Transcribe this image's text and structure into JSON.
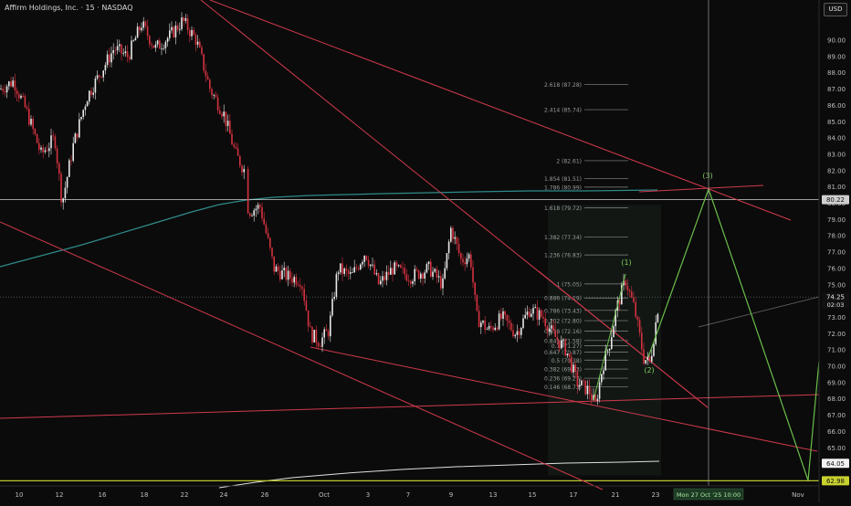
{
  "header": {
    "title": "Affirm Holdings, Inc. · 15 · NASDAQ",
    "currency_button": "USD"
  },
  "chart_data": {
    "type": "candlestick",
    "ticker_title": "Affirm Holdings, Inc. · 15 · NASDAQ",
    "ylim": [
      62.6,
      91.4
    ],
    "y_ticks": [
      63,
      64,
      65,
      66,
      67,
      68,
      69,
      70,
      71,
      72,
      73,
      74,
      75,
      76,
      77,
      78,
      79,
      80,
      81,
      82,
      83,
      84,
      85,
      86,
      87,
      88,
      89,
      90
    ],
    "y_tick_labels": [
      "63.00",
      "64.00",
      "65.00",
      "66.00",
      "67.00",
      "68.00",
      "69.00",
      "70.00",
      "71.00",
      "72.00",
      "73.00",
      "74.00",
      "75.00",
      "76.00",
      "77.00",
      "78.00",
      "79.00",
      "80.00",
      "81.00",
      "82.00",
      "83.00",
      "84.00",
      "85.00",
      "86.00",
      "87.00",
      "88.00",
      "89.00",
      "90.00"
    ],
    "x_tick_labels": [
      "10",
      "12",
      "16",
      "18",
      "22",
      "24",
      "26",
      "Oct",
      "3",
      "7",
      "9",
      "13",
      "15",
      "17",
      "21",
      "23",
      "Nov"
    ],
    "price_labels": [
      {
        "value": 80.22,
        "text": "80.22",
        "bg": "#cfcfcf",
        "fg": "#111111"
      },
      {
        "value": 74.25,
        "text": "74.25",
        "sub": "02:03",
        "bg": "#101010",
        "fg": "#e8e8e8"
      },
      {
        "value": 64.05,
        "text": "64.05",
        "bg": "#f2f2f2",
        "fg": "#111111"
      },
      {
        "value": 62.98,
        "text": "62.98",
        "bg": "#c9d12f",
        "fg": "#111111"
      }
    ],
    "crosshair": {
      "value": 80.22,
      "time_label": "Mon 27 Oct '25   10:00"
    },
    "fibonacci_levels": [
      {
        "label": "0.146 (68.73)",
        "value": 68.73
      },
      {
        "label": "0.236 (69.27)",
        "value": 69.27
      },
      {
        "label": "0.382 (69.83)",
        "value": 69.83
      },
      {
        "label": "0.5 (70.38)",
        "value": 70.38
      },
      {
        "label": "0.647 (70.87)",
        "value": 70.87
      },
      {
        "label": "0.7 (71.27)",
        "value": 71.27
      },
      {
        "label": "0.841 (71.58)",
        "value": 71.58
      },
      {
        "label": "0.618 (72.16)",
        "value": 72.16
      },
      {
        "label": "0.702 (72.80)",
        "value": 72.8
      },
      {
        "label": "0.786 (73.43)",
        "value": 73.43
      },
      {
        "label": "0.886 (74.19)",
        "value": 74.19
      },
      {
        "label": "1 (75.05)",
        "value": 75.05
      },
      {
        "label": "1.236 (76.83)",
        "value": 76.83
      },
      {
        "label": "1.382 (77.34)",
        "value": 77.94
      },
      {
        "label": "1.618 (79.72)",
        "value": 79.72
      },
      {
        "label": "1.786 (80.99)",
        "value": 80.99
      },
      {
        "label": "1.854 (81.51)",
        "value": 81.51
      },
      {
        "label": "2 (82.61)",
        "value": 82.61
      },
      {
        "label": "2.414 (85.74)",
        "value": 85.74
      },
      {
        "label": "2.618 (87.28)",
        "value": 87.28
      }
    ],
    "wave_labels": [
      {
        "label": "(1)",
        "value": 75.6
      },
      {
        "label": "(2)",
        "value": 69.4
      },
      {
        "label": "(3)",
        "value": 80.7
      }
    ],
    "candles_summary": {
      "start_value": 87.0,
      "low_value": 67.6,
      "last_value": 74.25
    },
    "colors": {
      "background": "#0b0b0b",
      "up": "#e8e8e8",
      "down": "#d5323f",
      "trendline": "#d03a4c",
      "projection": "#6bbf4a",
      "ma_teal": "#2f8a8a",
      "ma_white": "#e0e0e0",
      "fib_line": "#8a8a8a",
      "support_yellow": "#b9c631"
    }
  }
}
